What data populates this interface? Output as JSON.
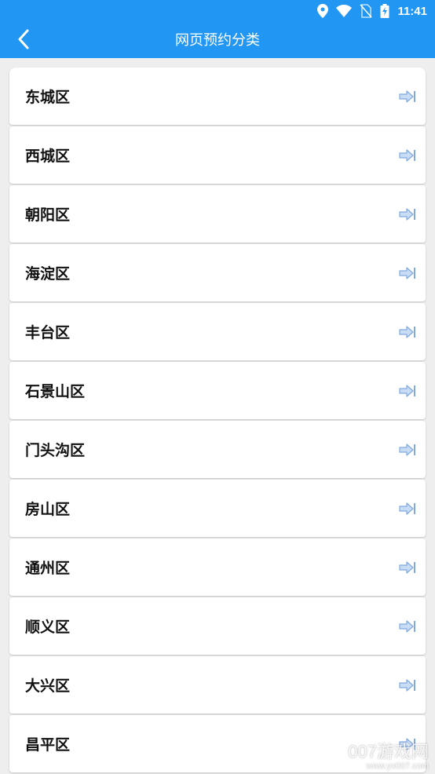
{
  "status_bar": {
    "time": "11:41",
    "icons": [
      "location-icon",
      "wifi-icon",
      "no-sim-icon",
      "battery-charging-icon"
    ]
  },
  "header": {
    "title": "网页预约分类",
    "back_icon": "back-arrow-icon"
  },
  "districts": [
    {
      "label": "东城区"
    },
    {
      "label": "西城区"
    },
    {
      "label": "朝阳区"
    },
    {
      "label": "海淀区"
    },
    {
      "label": "丰台区"
    },
    {
      "label": "石景山区"
    },
    {
      "label": "门头沟区"
    },
    {
      "label": "房山区"
    },
    {
      "label": "通州区"
    },
    {
      "label": "顺义区"
    },
    {
      "label": "大兴区"
    },
    {
      "label": "昌平区"
    }
  ],
  "row_icon": "enter-arrow-icon",
  "watermark": {
    "main": "007游戏网",
    "url": "www.yx007.com"
  },
  "colors": {
    "primary": "#2196f3",
    "background": "#eeeeee",
    "arrow": "#8fb8ea"
  }
}
